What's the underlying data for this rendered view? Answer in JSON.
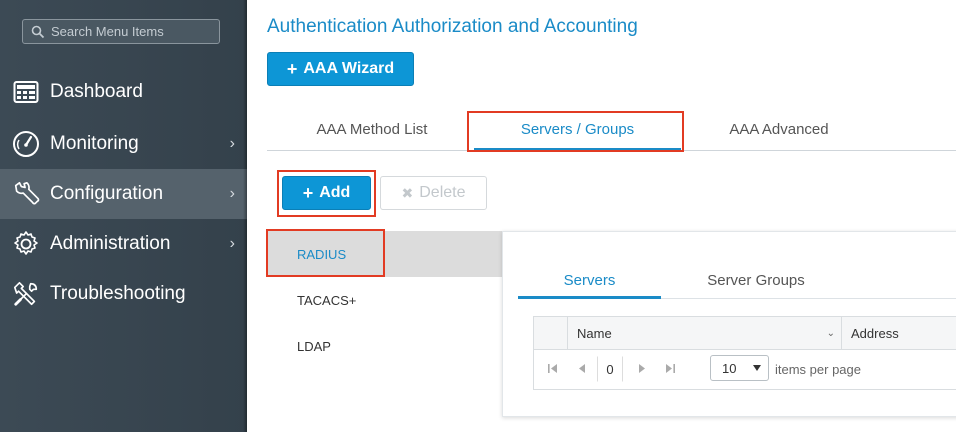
{
  "sidebar": {
    "search_placeholder": "Search Menu Items",
    "items": [
      {
        "label": "Dashboard",
        "icon": "dashboard-icon",
        "chevron": false,
        "active": false
      },
      {
        "label": "Monitoring",
        "icon": "gauge-icon",
        "chevron": true,
        "active": false
      },
      {
        "label": "Configuration",
        "icon": "wrench-icon",
        "chevron": true,
        "active": true
      },
      {
        "label": "Administration",
        "icon": "gear-icon",
        "chevron": true,
        "active": false
      },
      {
        "label": "Troubleshooting",
        "icon": "tools-icon",
        "chevron": false,
        "active": false
      }
    ],
    "chevron_glyph": "›"
  },
  "page": {
    "title": "Authentication Authorization and Accounting",
    "wizard_label": "AAA Wizard"
  },
  "main_tabs": [
    {
      "label": "AAA Method List",
      "active": false
    },
    {
      "label": "Servers / Groups",
      "active": true
    },
    {
      "label": "AAA Advanced",
      "active": false
    }
  ],
  "actions": {
    "add_label": "Add",
    "delete_label": "Delete"
  },
  "server_types": [
    {
      "label": "RADIUS",
      "active": true
    },
    {
      "label": "TACACS+",
      "active": false
    },
    {
      "label": "LDAP",
      "active": false
    }
  ],
  "sub_tabs": [
    {
      "label": "Servers",
      "active": true
    },
    {
      "label": "Server Groups",
      "active": false
    }
  ],
  "grid": {
    "columns": [
      "Name",
      "Address"
    ],
    "current_page": "0",
    "items_per_page": "10",
    "items_per_page_label": "items per page"
  },
  "colors": {
    "accent": "#1a8bc7",
    "primary_button": "#0d96d6",
    "highlight": "#e23b23",
    "sidebar": "#3c4a55"
  }
}
